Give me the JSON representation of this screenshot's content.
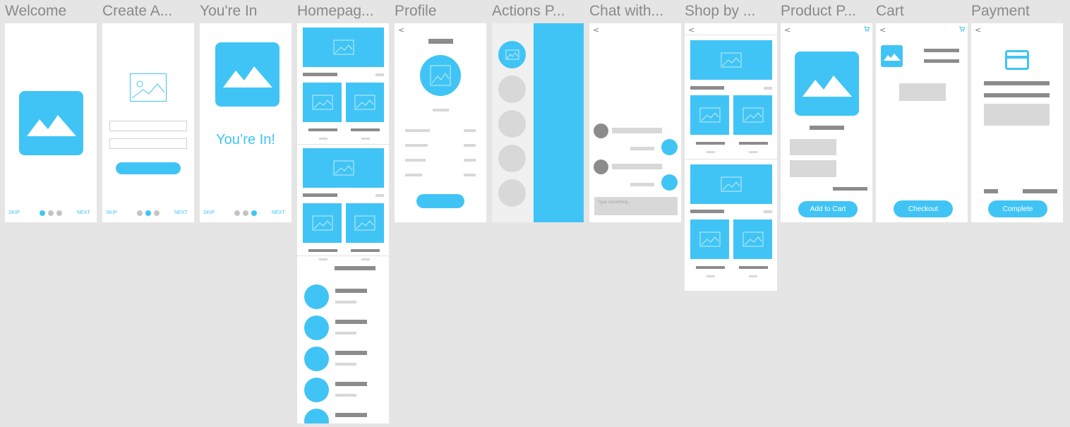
{
  "frames": {
    "welcome": {
      "title": "Welcome",
      "skip": "SKIP",
      "next": "NEXT"
    },
    "create": {
      "title": "Create A...",
      "skip": "SKIP",
      "next": "NEXT"
    },
    "in": {
      "title": "You're In",
      "headline": "You’re In!",
      "skip": "SKIP",
      "next": "NEXT"
    },
    "home": {
      "title": "Homepag..."
    },
    "profile": {
      "title": "Profile",
      "back": "<"
    },
    "actions": {
      "title": "Actions P..."
    },
    "chat": {
      "title": "Chat with...",
      "back": "<",
      "input_placeholder": "Type something..."
    },
    "shop": {
      "title": "Shop by ...",
      "back": "<"
    },
    "product": {
      "title": "Product P...",
      "back": "<",
      "add_to_cart": "Add to Cart"
    },
    "cart": {
      "title": "Cart",
      "back": "<",
      "checkout": "Checkout"
    },
    "payment": {
      "title": "Payment",
      "back": "<",
      "complete": "Complete"
    }
  },
  "colors": {
    "accent": "#40c4f5",
    "placeholder_dark": "#8c8c8c",
    "placeholder_light": "#d8d8d8",
    "canvas": "#e5e5e5"
  },
  "icons": [
    "image-placeholder-icon",
    "mountain-image-icon",
    "back-chevron-icon",
    "cart-icon",
    "credit-card-icon"
  ]
}
